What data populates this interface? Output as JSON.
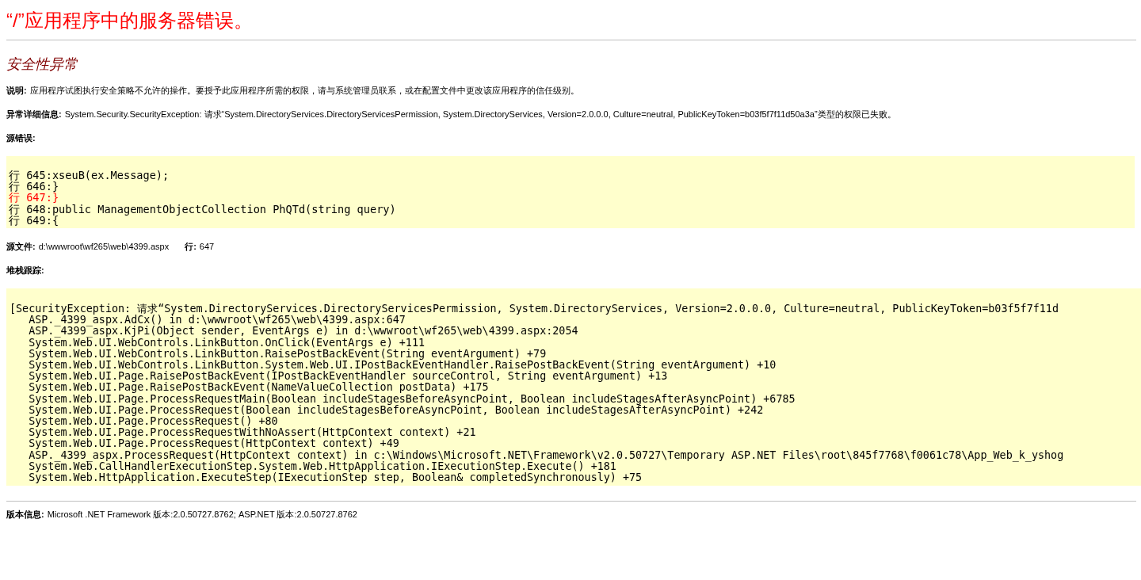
{
  "title": "“/”应用程序中的服务器错误。",
  "exception_title": "安全性异常",
  "description": {
    "label": "说明:",
    "text": "应用程序试图执行安全策略不允许的操作。要授予此应用程序所需的权限，请与系统管理员联系，或在配置文件中更改该应用程序的信任级别。"
  },
  "details": {
    "label": "异常详细信息:",
    "text": "System.Security.SecurityException: 请求“System.DirectoryServices.DirectoryServicesPermission, System.DirectoryServices, Version=2.0.0.0, Culture=neutral, PublicKeyToken=b03f5f7f11d50a3a”类型的权限已失败。"
  },
  "source_error": {
    "label": "源错误:",
    "lines": [
      {
        "text": "行 645:xseuB(ex.Message);",
        "highlighted": false
      },
      {
        "text": "行 646:}",
        "highlighted": false
      },
      {
        "text": "行 647:}",
        "highlighted": true
      },
      {
        "text": "行 648:public ManagementObjectCollection PhQTd(string query)",
        "highlighted": false
      },
      {
        "text": "行 649:{",
        "highlighted": false
      }
    ]
  },
  "source_file": {
    "label": "源文件:",
    "path": "d:\\wwwroot\\wf265\\web\\4399.aspx",
    "line_label": "行:",
    "line": "647"
  },
  "stack_trace": {
    "label": "堆栈跟踪:",
    "lines": [
      "[SecurityException: 请求“System.DirectoryServices.DirectoryServicesPermission, System.DirectoryServices, Version=2.0.0.0, Culture=neutral, PublicKeyToken=b03f5f7f11d",
      "   ASP._4399_aspx.AdCx() in d:\\wwwroot\\wf265\\web\\4399.aspx:647",
      "   ASP._4399_aspx.KjPi(Object sender, EventArgs e) in d:\\wwwroot\\wf265\\web\\4399.aspx:2054",
      "   System.Web.UI.WebControls.LinkButton.OnClick(EventArgs e) +111",
      "   System.Web.UI.WebControls.LinkButton.RaisePostBackEvent(String eventArgument) +79",
      "   System.Web.UI.WebControls.LinkButton.System.Web.UI.IPostBackEventHandler.RaisePostBackEvent(String eventArgument) +10",
      "   System.Web.UI.Page.RaisePostBackEvent(IPostBackEventHandler sourceControl, String eventArgument) +13",
      "   System.Web.UI.Page.RaisePostBackEvent(NameValueCollection postData) +175",
      "   System.Web.UI.Page.ProcessRequestMain(Boolean includeStagesBeforeAsyncPoint, Boolean includeStagesAfterAsyncPoint) +6785",
      "   System.Web.UI.Page.ProcessRequest(Boolean includeStagesBeforeAsyncPoint, Boolean includeStagesAfterAsyncPoint) +242",
      "   System.Web.UI.Page.ProcessRequest() +80",
      "   System.Web.UI.Page.ProcessRequestWithNoAssert(HttpContext context) +21",
      "   System.Web.UI.Page.ProcessRequest(HttpContext context) +49",
      "   ASP._4399_aspx.ProcessRequest(HttpContext context) in c:\\Windows\\Microsoft.NET\\Framework\\v2.0.50727\\Temporary ASP.NET Files\\root\\845f7768\\f0061c78\\App_Web_k_yshog",
      "   System.Web.CallHandlerExecutionStep.System.Web.HttpApplication.IExecutionStep.Execute() +181",
      "   System.Web.HttpApplication.ExecuteStep(IExecutionStep step, Boolean& completedSynchronously) +75"
    ]
  },
  "version": {
    "label": "版本信息:",
    "text": "Microsoft .NET Framework 版本:2.0.50727.8762; ASP.NET 版本:2.0.50727.8762"
  }
}
